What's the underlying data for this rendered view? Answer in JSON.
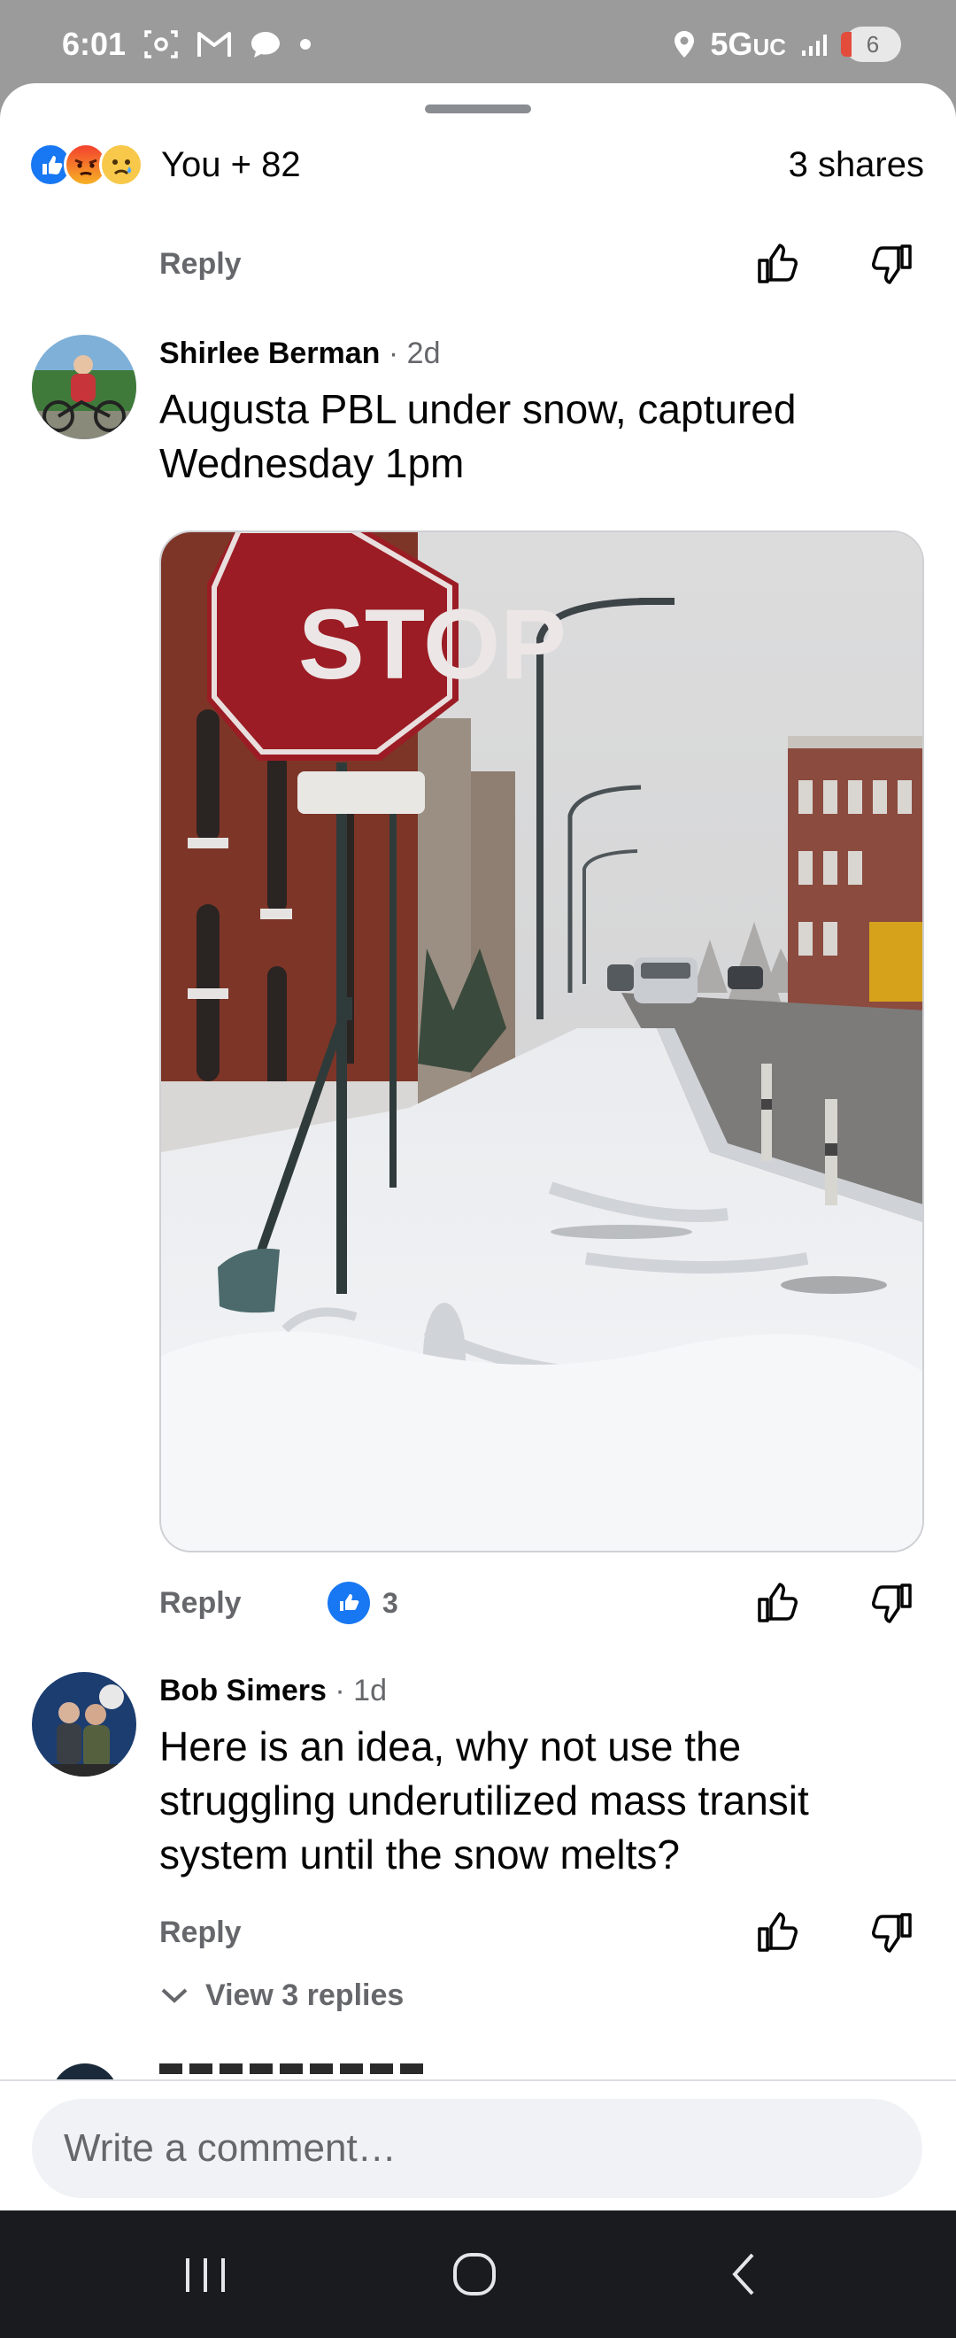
{
  "status_bar": {
    "time": "6:01",
    "network": "5G",
    "network_suffix": "UC",
    "battery": "6",
    "icons": [
      "screenshot-icon",
      "gmail-icon",
      "chat-bubble-icon",
      "dot-icon",
      "location-icon",
      "signal-icon",
      "battery-icon"
    ]
  },
  "header": {
    "reaction_icons": [
      "like-reaction-icon",
      "angry-reaction-icon",
      "sad-reaction-icon"
    ],
    "reaction_summary": "You + 82",
    "shares": "3 shares"
  },
  "comments": [
    {
      "reply_label": "Reply",
      "icons": [
        "thumbs-up-icon",
        "thumbs-down-icon"
      ]
    },
    {
      "author": "Shirlee Berman",
      "time": " · 2d",
      "text": "Augusta PBL under snow, captured Wednesday 1pm",
      "photo": "snowy-bike-lane-stop-sign-photo",
      "reply_label": "Reply",
      "reaction_count": "3",
      "icons": [
        "like-reaction-icon",
        "thumbs-up-icon",
        "thumbs-down-icon"
      ]
    },
    {
      "author": "Bob Simers",
      "time": " · 1d",
      "text": "Here is an idea, why not use the struggling underutilized mass transit system until the snow melts?",
      "reply_label": "Reply",
      "view_replies": "View 3 replies",
      "icons": [
        "chevron-down-icon",
        "thumbs-up-icon",
        "thumbs-down-icon"
      ]
    }
  ],
  "photo_sign_text": "STOP",
  "composer": {
    "placeholder": "Write a comment…"
  },
  "nav_bar": {
    "icons": [
      "recent-apps-icon",
      "home-icon",
      "back-icon"
    ]
  },
  "colors": {
    "accent": "#1877f2",
    "secondary_text": "#65676b",
    "status_bar": "#9b9b9b",
    "nav_bar": "#1a1b1f"
  }
}
